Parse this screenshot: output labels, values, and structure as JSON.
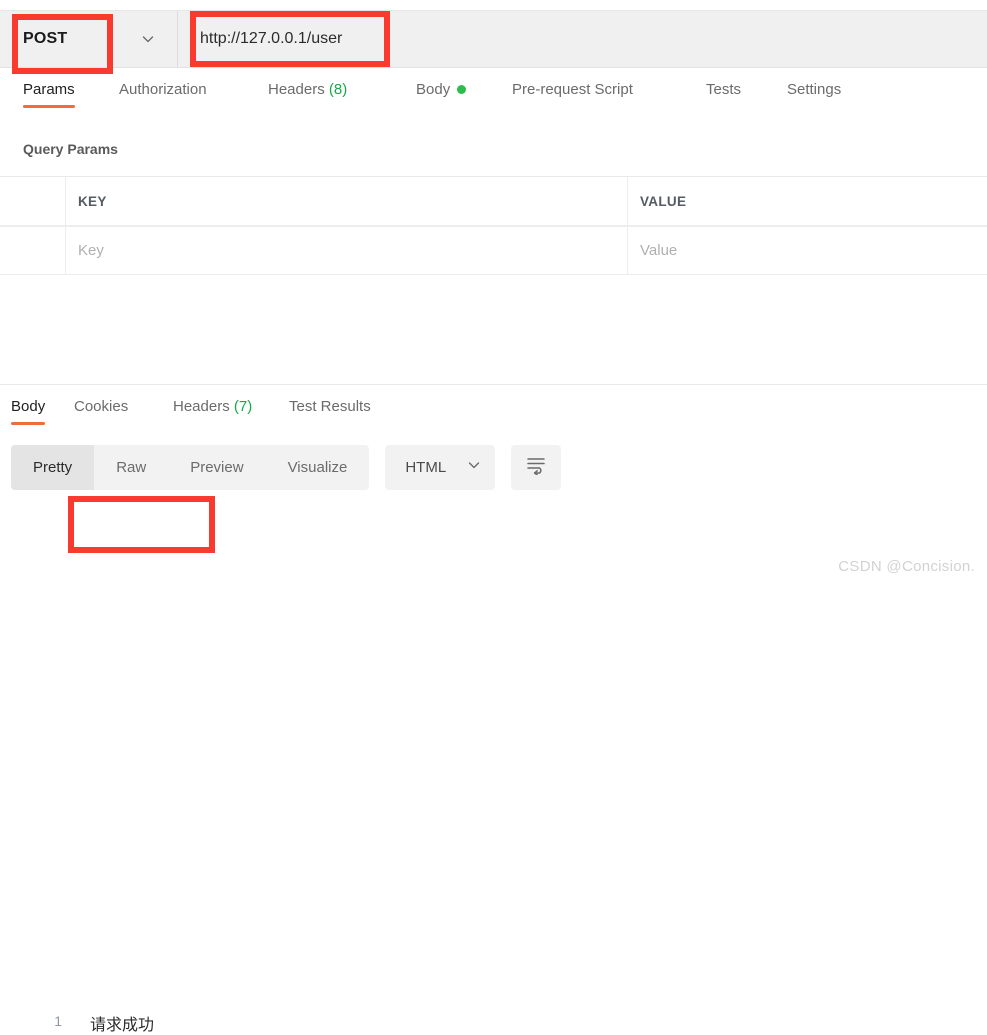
{
  "request_bar": {
    "method": "POST",
    "method_caret_icon": "chevron-down-icon",
    "url": "http://127.0.0.1/user"
  },
  "request_tabs": [
    {
      "label": "Params",
      "active": true,
      "count": "",
      "dot": false
    },
    {
      "label": "Authorization",
      "active": false,
      "count": "",
      "dot": false
    },
    {
      "label": "Headers",
      "active": false,
      "count": "(8)",
      "dot": false
    },
    {
      "label": "Body",
      "active": false,
      "count": "",
      "dot": true
    },
    {
      "label": "Pre-request Script",
      "active": false,
      "count": "",
      "dot": false
    },
    {
      "label": "Tests",
      "active": false,
      "count": "",
      "dot": false
    },
    {
      "label": "Settings",
      "active": false,
      "count": "",
      "dot": false
    }
  ],
  "query_params": {
    "title": "Query Params",
    "columns": [
      "KEY",
      "VALUE"
    ],
    "rows": [
      {
        "key_placeholder": "Key",
        "value_placeholder": "Value"
      }
    ]
  },
  "response_tabs": [
    {
      "label": "Body",
      "active": true,
      "count": ""
    },
    {
      "label": "Cookies",
      "active": false,
      "count": ""
    },
    {
      "label": "Headers",
      "active": false,
      "count": "(7)"
    },
    {
      "label": "Test Results",
      "active": false,
      "count": ""
    }
  ],
  "response_toolbar": {
    "view_modes": [
      {
        "label": "Pretty",
        "active": true
      },
      {
        "label": "Raw",
        "active": false
      },
      {
        "label": "Preview",
        "active": false
      },
      {
        "label": "Visualize",
        "active": false
      }
    ],
    "format": "HTML",
    "format_caret_icon": "chevron-down-icon",
    "wrap_icon": "wrap-lines-icon"
  },
  "response_body": {
    "line_number": "1",
    "content": "请求成功"
  },
  "watermark": "CSDN @Concision.",
  "colors": {
    "accent": "#f26b3a",
    "annotation": "#f93a2f",
    "ok_dot": "#2cbb4d",
    "count_green": "#1aa64b",
    "bar_bg": "#f0f0f0"
  }
}
